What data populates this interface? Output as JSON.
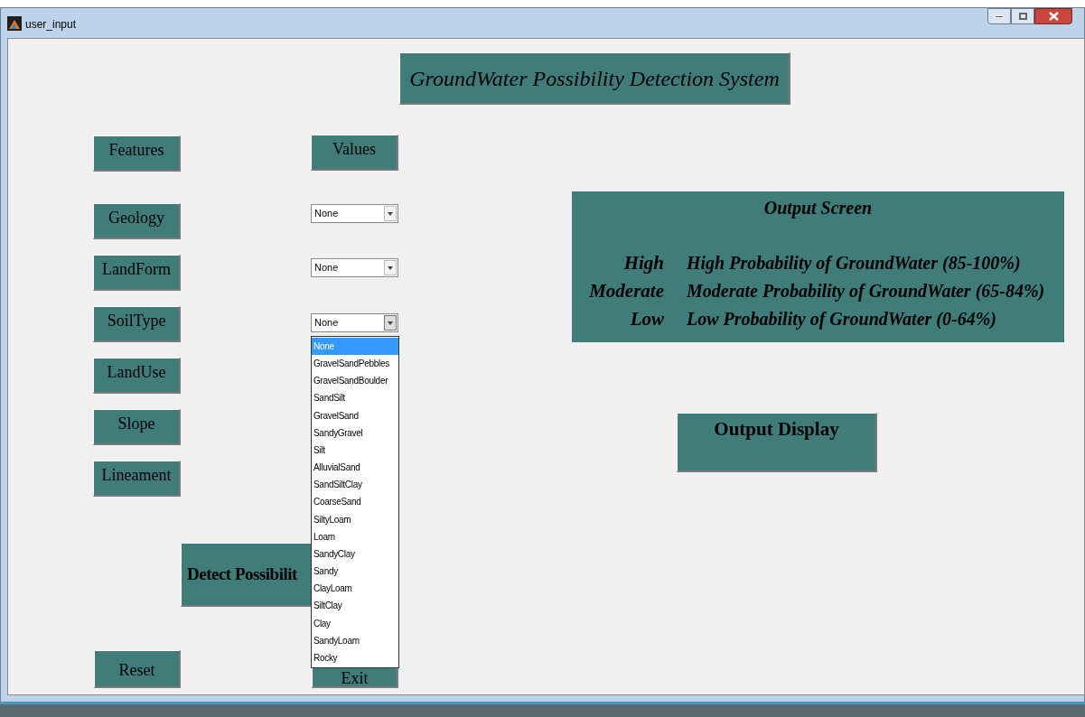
{
  "window": {
    "title": "user_input"
  },
  "header": "GroundWater Possibility Detection System",
  "columns": [
    "Features",
    "Values"
  ],
  "features": [
    {
      "label": "Geology",
      "value": "None",
      "expanded": false
    },
    {
      "label": "LandForm",
      "value": "None",
      "expanded": false
    },
    {
      "label": "SoilType",
      "value": "None",
      "expanded": true
    },
    {
      "label": "LandUse"
    },
    {
      "label": "Slope"
    },
    {
      "label": "Lineament"
    }
  ],
  "soil_options": [
    {
      "label": "None",
      "selected": true
    },
    {
      "label": "GravelSandPebbles",
      "selected": false
    },
    {
      "label": "GravelSandBoulder",
      "selected": false
    },
    {
      "label": "SandSilt",
      "selected": false
    },
    {
      "label": "GravelSand",
      "selected": false
    },
    {
      "label": "SandyGravel",
      "selected": false
    },
    {
      "label": "Silt",
      "selected": false
    },
    {
      "label": "AlluvialSand",
      "selected": false
    },
    {
      "label": "SandSiltClay",
      "selected": false
    },
    {
      "label": "CoarseSand",
      "selected": false
    },
    {
      "label": "SiltyLoam",
      "selected": false
    },
    {
      "label": "Loam",
      "selected": false
    },
    {
      "label": "SandyClay",
      "selected": false
    },
    {
      "label": "Sandy",
      "selected": false
    },
    {
      "label": "ClayLoam",
      "selected": false
    },
    {
      "label": "SiltClay",
      "selected": false
    },
    {
      "label": "Clay",
      "selected": false
    },
    {
      "label": "SandyLoam",
      "selected": false
    },
    {
      "label": "Rocky",
      "selected": false
    }
  ],
  "buttons": {
    "detect": "Detect Possibilit",
    "reset": "Reset",
    "exit": "Exit"
  },
  "output_screen": {
    "title": "Output Screen",
    "rows": [
      {
        "level": "High",
        "description": "High Probability of GroundWater (85-100%)"
      },
      {
        "level": "Moderate",
        "description": "Moderate Probability of GroundWater (65-84%)"
      },
      {
        "level": "Low",
        "description": "Low Probability of GroundWater (0-64%)"
      }
    ]
  },
  "output_display": "Output Display"
}
